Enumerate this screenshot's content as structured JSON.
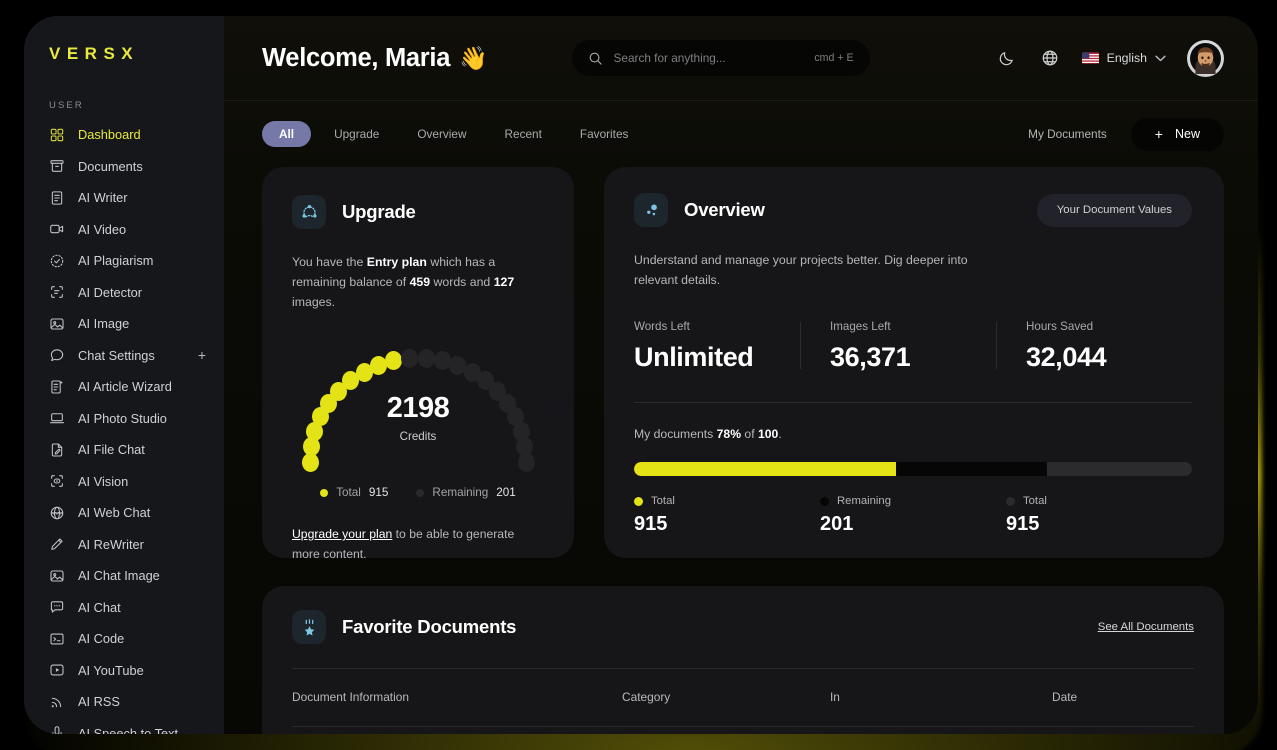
{
  "brand": {
    "logo": "VERSX"
  },
  "sidebar": {
    "section_label": "USER",
    "items": [
      {
        "label": "Dashboard",
        "icon": "grid-icon",
        "active": true
      },
      {
        "label": "Documents",
        "icon": "archive-icon",
        "active": false
      },
      {
        "label": "AI Writer",
        "icon": "document-icon",
        "active": false
      },
      {
        "label": "AI Video",
        "icon": "video-icon",
        "active": false
      },
      {
        "label": "AI Plagiarism",
        "icon": "check-dashed-icon",
        "active": false
      },
      {
        "label": "AI Detector",
        "icon": "scan-text-icon",
        "active": false
      },
      {
        "label": "AI Image",
        "icon": "image-icon",
        "active": false
      },
      {
        "label": "Chat Settings",
        "icon": "chat-bubble-icon",
        "active": false,
        "trailing": "+"
      },
      {
        "label": "AI Article Wizard",
        "icon": "article-icon",
        "active": false
      },
      {
        "label": "AI Photo Studio",
        "icon": "laptop-icon",
        "active": false
      },
      {
        "label": "AI File Chat",
        "icon": "file-edit-icon",
        "active": false
      },
      {
        "label": "AI Vision",
        "icon": "eye-scan-icon",
        "active": false
      },
      {
        "label": "AI Web Chat",
        "icon": "globe-www-icon",
        "active": false
      },
      {
        "label": "AI ReWriter",
        "icon": "pencil-icon",
        "active": false
      },
      {
        "label": "AI Chat Image",
        "icon": "image-icon",
        "active": false
      },
      {
        "label": "AI Chat",
        "icon": "chat-dots-icon",
        "active": false
      },
      {
        "label": "AI Code",
        "icon": "terminal-icon",
        "active": false
      },
      {
        "label": "AI YouTube",
        "icon": "play-box-icon",
        "active": false
      },
      {
        "label": "AI RSS",
        "icon": "rss-icon",
        "active": false
      },
      {
        "label": "AI Speech to Text",
        "icon": "microphone-icon",
        "active": false
      }
    ]
  },
  "header": {
    "welcome": "Welcome, Maria",
    "wave_emoji": "👋",
    "search": {
      "placeholder": "Search for anything...",
      "value": "",
      "shortcut": "cmd + E"
    },
    "theme_icon": "moon-icon",
    "globe_icon": "globe-icon",
    "language": "English",
    "language_flag": "us-flag-icon",
    "chevron": "⌄"
  },
  "tabs": {
    "items": [
      {
        "label": "All",
        "active": true
      },
      {
        "label": "Upgrade",
        "active": false
      },
      {
        "label": "Overview",
        "active": false
      },
      {
        "label": "Recent",
        "active": false
      },
      {
        "label": "Favorites",
        "active": false
      }
    ],
    "my_documents": "My Documents",
    "new_button": "New",
    "new_plus": "+"
  },
  "upgrade_card": {
    "icon": "share-nodes-icon",
    "title": "Upgrade",
    "desc_prefix": "You have the ",
    "plan": "Entry plan",
    "desc_mid": " which has a remaining balance of ",
    "words": "459",
    "desc_mid2": " words and ",
    "images": "127",
    "desc_suffix": " images.",
    "credits_value": "2198",
    "credits_label": "Credits",
    "legend": [
      {
        "label": "Total",
        "value": "915",
        "color": "#e3e315"
      },
      {
        "label": "Remaining",
        "value": "201",
        "color": "#2a2a2c"
      }
    ],
    "footer_link": "Upgrade your plan",
    "footer_text": " to be able to generate more content."
  },
  "overview_card": {
    "icon": "dots-icon",
    "title": "Overview",
    "action_button": "Your Document Values",
    "description": "Understand and manage your projects better. Dig deeper into relevant details.",
    "stats": [
      {
        "label": "Words Left",
        "value": "Unlimited"
      },
      {
        "label": "Images Left",
        "value": "36,371"
      },
      {
        "label": "Hours Saved",
        "value": "32,044"
      }
    ],
    "docs_prefix": "My documents ",
    "docs_percent": "78%",
    "docs_mid": " of ",
    "docs_total": "100",
    "docs_suffix": ".",
    "bar_legend": [
      {
        "label": "Total",
        "value": "915",
        "color": "#e3e315"
      },
      {
        "label": "Remaining",
        "value": "201",
        "color": "#060606"
      },
      {
        "label": "Total",
        "value": "915",
        "color": "#2b2b2d"
      }
    ]
  },
  "favorites_card": {
    "icon": "star-badge-icon",
    "title": "Favorite Documents",
    "see_all": "See All Documents",
    "columns": [
      "Document Information",
      "Category",
      "In",
      "Date"
    ]
  },
  "chart_data": [
    {
      "type": "gauge",
      "title": "Credits",
      "center_value": 2198,
      "total_dots": 22,
      "filled_dots": 10,
      "filled_color": "#e3e315",
      "empty_color": "#242426",
      "series": [
        {
          "name": "Total",
          "value": 915
        },
        {
          "name": "Remaining",
          "value": 201
        }
      ]
    },
    {
      "type": "bar",
      "title": "My documents 78% of 100.",
      "orientation": "horizontal-stacked",
      "categories": [
        "Total",
        "Remaining",
        "Total"
      ],
      "values": [
        915,
        201,
        915
      ],
      "segment_percent": [
        47,
        27,
        26
      ],
      "colors": [
        "#e3e315",
        "#060606",
        "#2b2b2d"
      ]
    }
  ],
  "theme": {
    "accent_yellow": "#e3e315",
    "tab_active": "#7678a8",
    "card_bg": "#161618",
    "panel_bg": "#0b0b06",
    "sidebar_bg": "#16171a"
  }
}
